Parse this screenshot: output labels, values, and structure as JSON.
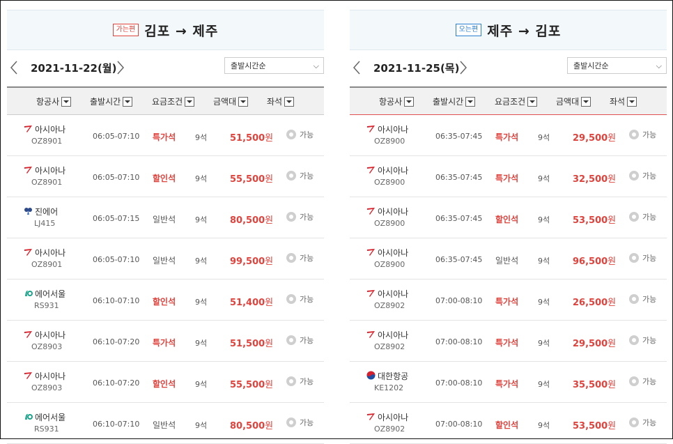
{
  "outbound": {
    "badge": "가는편",
    "route": "김포 → 제주",
    "date": "2021-11-22(월)",
    "sort": "출발시간순",
    "headers": [
      "항공사",
      "출발시간",
      "요금조건",
      "금액대",
      "좌석"
    ],
    "rows": [
      {
        "airline": "아시아나",
        "icon": "asiana-logo-icon",
        "flight": "OZ8901",
        "time": "06:05-07:10",
        "fare": "특가석",
        "fare_style": "red",
        "seats": "9석",
        "price": "51,500",
        "unit": "원",
        "status": "가능"
      },
      {
        "airline": "아시아나",
        "icon": "asiana-logo-icon",
        "flight": "OZ8901",
        "time": "06:05-07:10",
        "fare": "할인석",
        "fare_style": "red",
        "seats": "9석",
        "price": "55,500",
        "unit": "원",
        "status": "가능"
      },
      {
        "airline": "진에어",
        "icon": "jinair-logo-icon",
        "flight": "LJ415",
        "time": "06:05-07:15",
        "fare": "일반석",
        "fare_style": "gray",
        "seats": "9석",
        "price": "80,500",
        "unit": "원",
        "status": "가능"
      },
      {
        "airline": "아시아나",
        "icon": "asiana-logo-icon",
        "flight": "OZ8901",
        "time": "06:05-07:10",
        "fare": "일반석",
        "fare_style": "gray",
        "seats": "9석",
        "price": "99,500",
        "unit": "원",
        "status": "가능"
      },
      {
        "airline": "에어서울",
        "icon": "airseoul-logo-icon",
        "flight": "RS931",
        "time": "06:10-07:10",
        "fare": "할인석",
        "fare_style": "red",
        "seats": "9석",
        "price": "51,400",
        "unit": "원",
        "status": "가능"
      },
      {
        "airline": "아시아나",
        "icon": "asiana-logo-icon",
        "flight": "OZ8903",
        "time": "06:10-07:20",
        "fare": "특가석",
        "fare_style": "red",
        "seats": "9석",
        "price": "51,500",
        "unit": "원",
        "status": "가능"
      },
      {
        "airline": "아시아나",
        "icon": "asiana-logo-icon",
        "flight": "OZ8903",
        "time": "06:10-07:20",
        "fare": "할인석",
        "fare_style": "red",
        "seats": "9석",
        "price": "55,500",
        "unit": "원",
        "status": "가능"
      },
      {
        "airline": "에어서울",
        "icon": "airseoul-logo-icon",
        "flight": "RS931",
        "time": "06:10-07:10",
        "fare": "일반석",
        "fare_style": "gray",
        "seats": "9석",
        "price": "80,500",
        "unit": "원",
        "status": "가능"
      }
    ]
  },
  "inbound": {
    "badge": "오는편",
    "route": "제주 → 김포",
    "date": "2021-11-25(목)",
    "sort": "출발시간순",
    "headers": [
      "항공사",
      "출발시간",
      "요금조건",
      "금액대",
      "좌석"
    ],
    "rows": [
      {
        "airline": "아시아나",
        "icon": "asiana-logo-icon",
        "flight": "OZ8900",
        "time": "06:35-07:45",
        "fare": "특가석",
        "fare_style": "red",
        "seats": "9석",
        "price": "29,500",
        "unit": "원",
        "status": "가능"
      },
      {
        "airline": "아시아나",
        "icon": "asiana-logo-icon",
        "flight": "OZ8900",
        "time": "06:35-07:45",
        "fare": "특가석",
        "fare_style": "red",
        "seats": "9석",
        "price": "32,500",
        "unit": "원",
        "status": "가능"
      },
      {
        "airline": "아시아나",
        "icon": "asiana-logo-icon",
        "flight": "OZ8900",
        "time": "06:35-07:45",
        "fare": "할인석",
        "fare_style": "red",
        "seats": "9석",
        "price": "53,500",
        "unit": "원",
        "status": "가능"
      },
      {
        "airline": "아시아나",
        "icon": "asiana-logo-icon",
        "flight": "OZ8900",
        "time": "06:35-07:45",
        "fare": "일반석",
        "fare_style": "gray",
        "seats": "9석",
        "price": "96,500",
        "unit": "원",
        "status": "가능"
      },
      {
        "airline": "아시아나",
        "icon": "asiana-logo-icon",
        "flight": "OZ8902",
        "time": "07:00-08:10",
        "fare": "특가석",
        "fare_style": "red",
        "seats": "9석",
        "price": "26,500",
        "unit": "원",
        "status": "가능"
      },
      {
        "airline": "아시아나",
        "icon": "asiana-logo-icon",
        "flight": "OZ8902",
        "time": "07:00-08:10",
        "fare": "특가석",
        "fare_style": "red",
        "seats": "9석",
        "price": "29,500",
        "unit": "원",
        "status": "가능"
      },
      {
        "airline": "대한항공",
        "icon": "koreanair-logo-icon",
        "flight": "KE1202",
        "time": "07:00-08:10",
        "fare": "특가석",
        "fare_style": "red",
        "seats": "9석",
        "price": "35,500",
        "unit": "원",
        "status": "가능"
      },
      {
        "airline": "아시아나",
        "icon": "asiana-logo-icon",
        "flight": "OZ8902",
        "time": "07:00-08:10",
        "fare": "할인석",
        "fare_style": "red",
        "seats": "9석",
        "price": "53,500",
        "unit": "원",
        "status": "가능"
      }
    ]
  },
  "colors": {
    "accent_red": "#e0423c",
    "badge_blue": "#2a7fd1",
    "header_bg": "#f3f8fb"
  }
}
